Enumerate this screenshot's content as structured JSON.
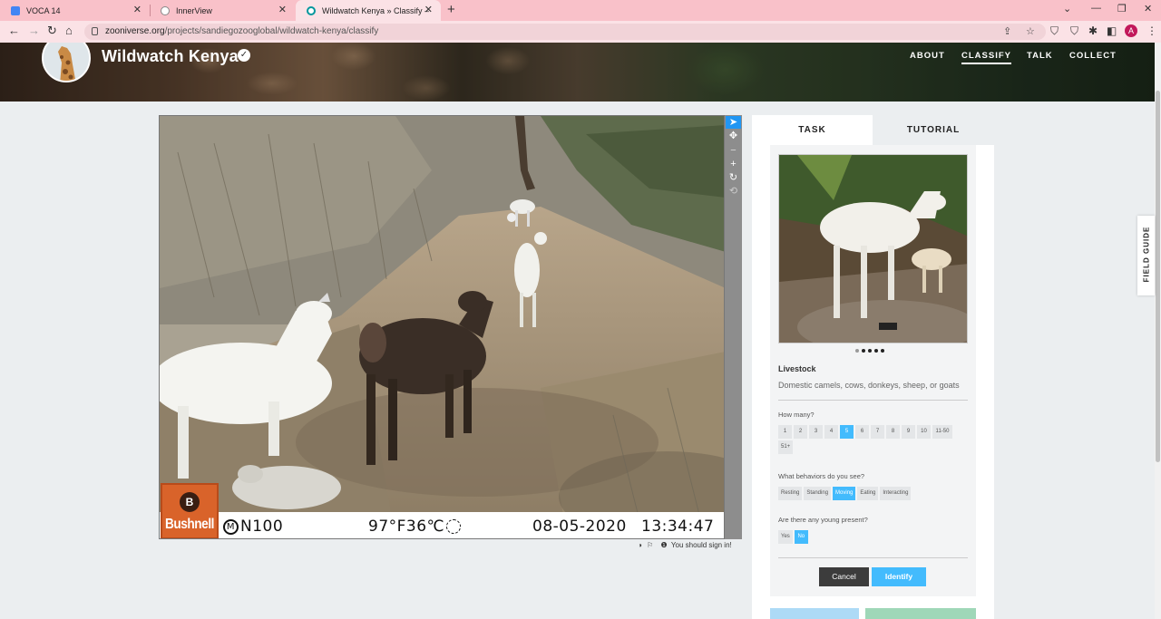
{
  "browser": {
    "tabs": [
      {
        "title": "VOCA 14",
        "favicon": "google-classroom-icon",
        "color": "#4285f4"
      },
      {
        "title": "InnerView",
        "favicon": "innerview-icon",
        "color": "#ffffff"
      },
      {
        "title": "Wildwatch Kenya » Classify — Zo",
        "favicon": "zooniverse-icon",
        "color": "#00979d",
        "active": true
      }
    ],
    "url_host": "zooniverse.org",
    "url_path": "/projects/sandiegozooglobal/wildwatch-kenya/classify",
    "avatar_letter": "A"
  },
  "header": {
    "title": "Wildwatch Kenya",
    "nav": [
      "ABOUT",
      "CLASSIFY",
      "TALK",
      "COLLECT"
    ],
    "active_nav": "CLASSIFY"
  },
  "viewer": {
    "camera_brand": "Bushnell",
    "moon_phase_label": "M",
    "camera_id": "N100",
    "temperature": "97°F36℃",
    "date": "08-05-2020",
    "time": "13:34:47",
    "tools": [
      "pointer-icon",
      "pan-icon",
      "zoom-out-icon",
      "zoom-in-icon",
      "rotate-icon",
      "reset-icon"
    ],
    "sign_in_notice": "You should sign in!"
  },
  "task": {
    "tabs": [
      "TASK",
      "TUTORIAL"
    ],
    "choice_name": "Livestock",
    "choice_description": "Domestic camels, cows, donkeys, sheep, or goats",
    "image_dots": 5,
    "current_dot": 0,
    "questions": [
      {
        "label": "How many?",
        "options": [
          "1",
          "2",
          "3",
          "4",
          "5",
          "6",
          "7",
          "8",
          "9",
          "10",
          "11-50",
          "51+"
        ],
        "selected": "5"
      },
      {
        "label": "What behaviors do you see?",
        "options": [
          "Resting",
          "Standing",
          "Moving",
          "Eating",
          "Interacting"
        ],
        "selected": "Moving"
      },
      {
        "label": "Are there any young present?",
        "options": [
          "Yes",
          "No"
        ],
        "selected": "No"
      }
    ],
    "cancel_label": "Cancel",
    "identify_label": "Identify"
  },
  "field_guide_label": "FIELD GUIDE"
}
